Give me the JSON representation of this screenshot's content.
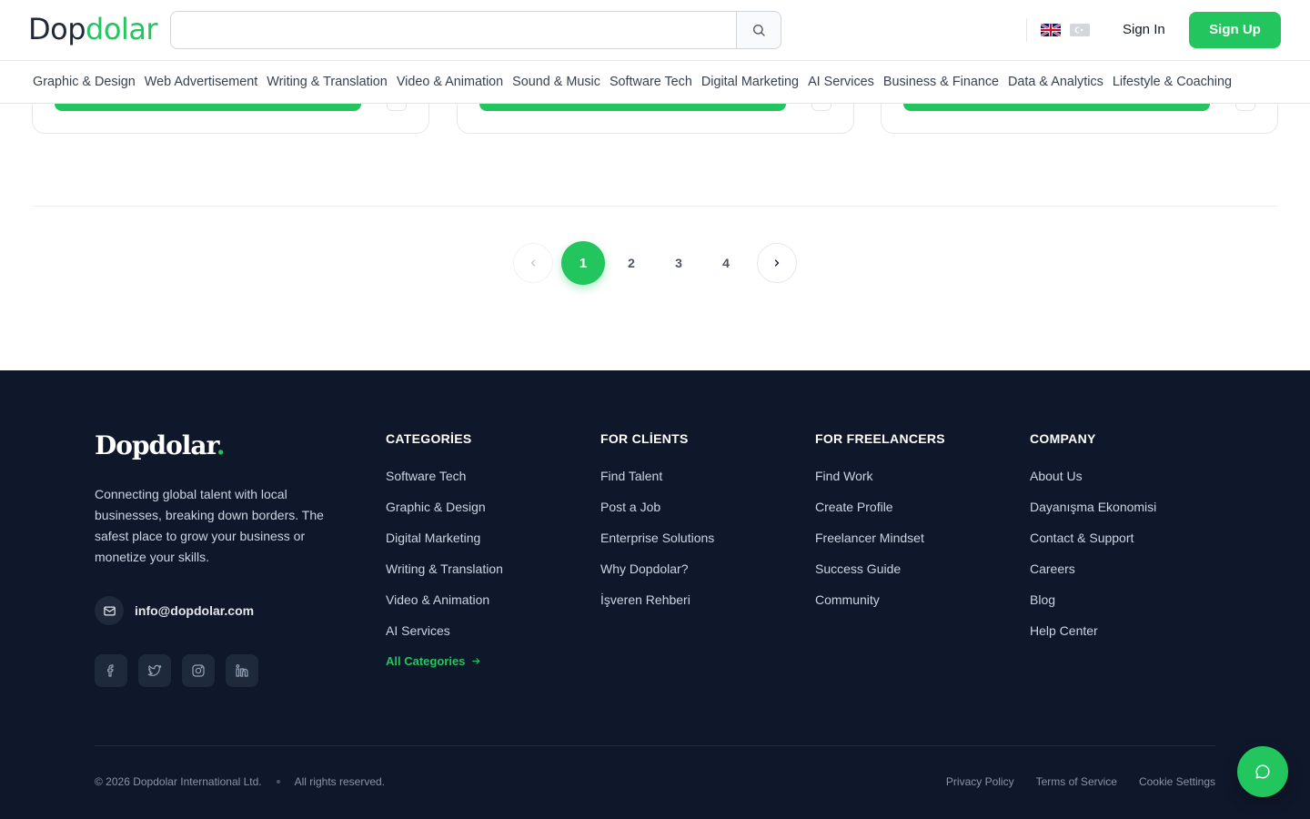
{
  "header": {
    "logo_dark": "Dop",
    "logo_accent": "dolar",
    "search_placeholder": "",
    "search_value": "",
    "sign_in": "Sign In",
    "sign_up": "Sign Up"
  },
  "categories_nav": [
    "Graphic & Design",
    "Web Advertisement",
    "Writing & Translation",
    "Video & Animation",
    "Sound & Music",
    "Software Tech",
    "Digital Marketing",
    "AI Services",
    "Business & Finance",
    "Data & Analytics",
    "Lifestyle & Coaching"
  ],
  "pagination": {
    "pages": [
      "1",
      "2",
      "3",
      "4"
    ],
    "current": "1"
  },
  "footer": {
    "brand": "Dopdolar",
    "brand_dot": ".",
    "description": "Connecting global talent with local businesses, breaking down borders. The safest place to grow your business or monetize your skills.",
    "email": "info@dopdolar.com",
    "columns": {
      "categories": {
        "title": "CATEGORİES",
        "items": [
          "Software Tech",
          "Graphic & Design",
          "Digital Marketing",
          "Writing & Translation",
          "Video & Animation",
          "AI Services"
        ],
        "all_link": "All Categories"
      },
      "clients": {
        "title": "FOR CLİENTS",
        "items": [
          "Find Talent",
          "Post a Job",
          "Enterprise Solutions",
          "Why Dopdolar?",
          "İşveren Rehberi"
        ]
      },
      "freelancers": {
        "title": "FOR FREELANCERS",
        "items": [
          "Find Work",
          "Create Profile",
          "Freelancer Mindset",
          "Success Guide",
          "Community"
        ]
      },
      "company": {
        "title": "COMPANY",
        "items": [
          "About Us",
          "Dayanışma Ekonomisi",
          "Contact & Support",
          "Careers",
          "Blog",
          "Help Center"
        ]
      }
    },
    "copyright": "© 2026 Dopdolar International Ltd.",
    "rights": "All rights reserved.",
    "legal": [
      "Privacy Policy",
      "Terms of Service",
      "Cookie Settings"
    ]
  },
  "colors": {
    "accent": "#22c55e",
    "footer_bg": "#0f172a"
  },
  "icons": [
    "search-icon",
    "uk-flag-icon",
    "tr-flag-icon",
    "chevron-left-icon",
    "chevron-right-icon",
    "mail-icon",
    "facebook-icon",
    "twitter-icon",
    "instagram-icon",
    "linkedin-icon",
    "arrow-right-icon",
    "chat-icon"
  ]
}
